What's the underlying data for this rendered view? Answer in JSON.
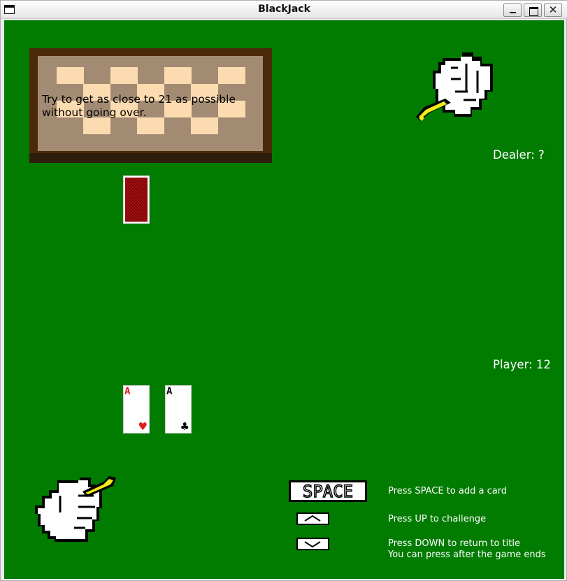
{
  "window": {
    "title": "BlackJack"
  },
  "colors": {
    "table_felt": "#017c01",
    "card_back": "#8a0a0a",
    "board_frame": "#4a2a08",
    "board_fill": "#a38b73",
    "board_checker": "#fcdbb0"
  },
  "sign": {
    "line1": "Try to get as close to 21 as possible",
    "line2": "without going over."
  },
  "dealer": {
    "score_label": "Dealer: ?",
    "cards": [
      {
        "face_down": true
      }
    ],
    "hand_icon": "pointing-hand-icon"
  },
  "player": {
    "score_label": "Player: 12",
    "cards": [
      {
        "rank": "A",
        "suit": "♥",
        "color": "red"
      },
      {
        "rank": "A",
        "suit": "♣",
        "color": "black"
      }
    ],
    "hand_icon": "pointing-hand-icon"
  },
  "controls": {
    "space_key": "SPACE",
    "space_help": "Press SPACE to add a card",
    "up_help": "Press UP to challenge",
    "down_help_line1": "Press DOWN to return to title",
    "down_help_line2": "You can press after the game ends"
  }
}
